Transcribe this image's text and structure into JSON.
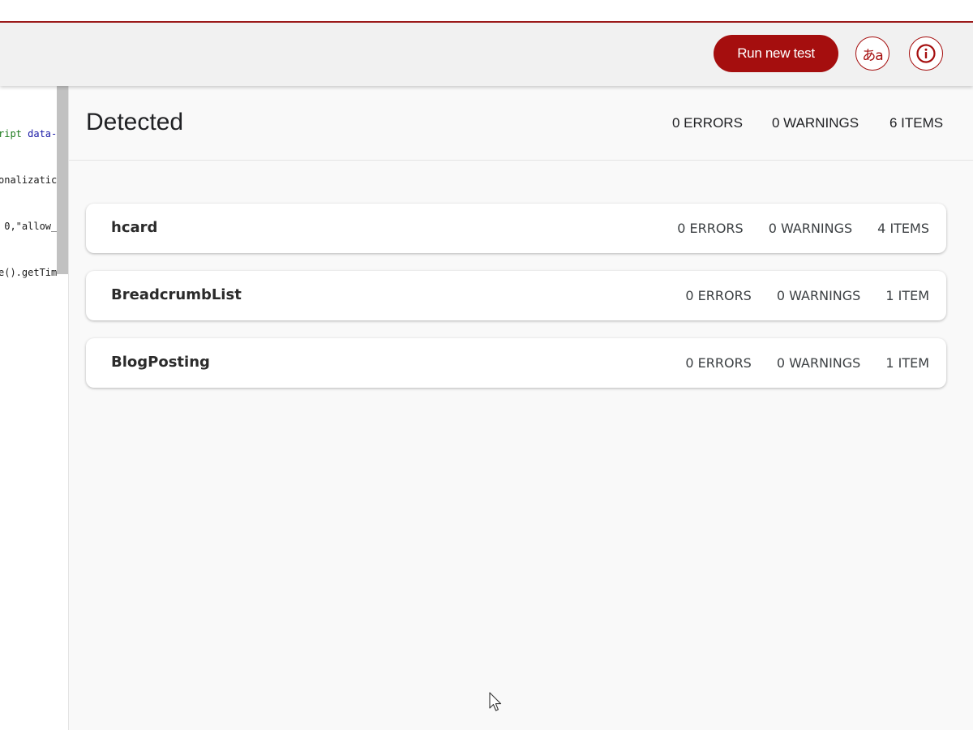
{
  "header": {
    "run_new_test_label": "Run new test",
    "language_icon_glyph": "あa",
    "icons": {
      "language": "language-icon",
      "info": "info-icon"
    },
    "accent_color": "#a50e0e"
  },
  "code_pane": {
    "lines": [
      {
        "a": "ript",
        "b": " data-",
        "a_color": "#1e7b1e",
        "b_color": "#1a1aa6"
      },
      {
        "a": "onalizatic",
        "b": ""
      },
      {
        "a": " 0,\"allow_",
        "b": ""
      },
      {
        "a": "e().getTim",
        "b": ""
      }
    ]
  },
  "results": {
    "title": "Detected",
    "summary": {
      "errors": "0 ERRORS",
      "warnings": "0 WARNINGS",
      "items": "6 ITEMS"
    },
    "entries": [
      {
        "name": "hcard",
        "errors": "0 ERRORS",
        "warnings": "0 WARNINGS",
        "items": "4 ITEMS"
      },
      {
        "name": "BreadcrumbList",
        "errors": "0 ERRORS",
        "warnings": "0 WARNINGS",
        "items": "1 ITEM"
      },
      {
        "name": "BlogPosting",
        "errors": "0 ERRORS",
        "warnings": "0 WARNINGS",
        "items": "1 ITEM"
      }
    ]
  }
}
